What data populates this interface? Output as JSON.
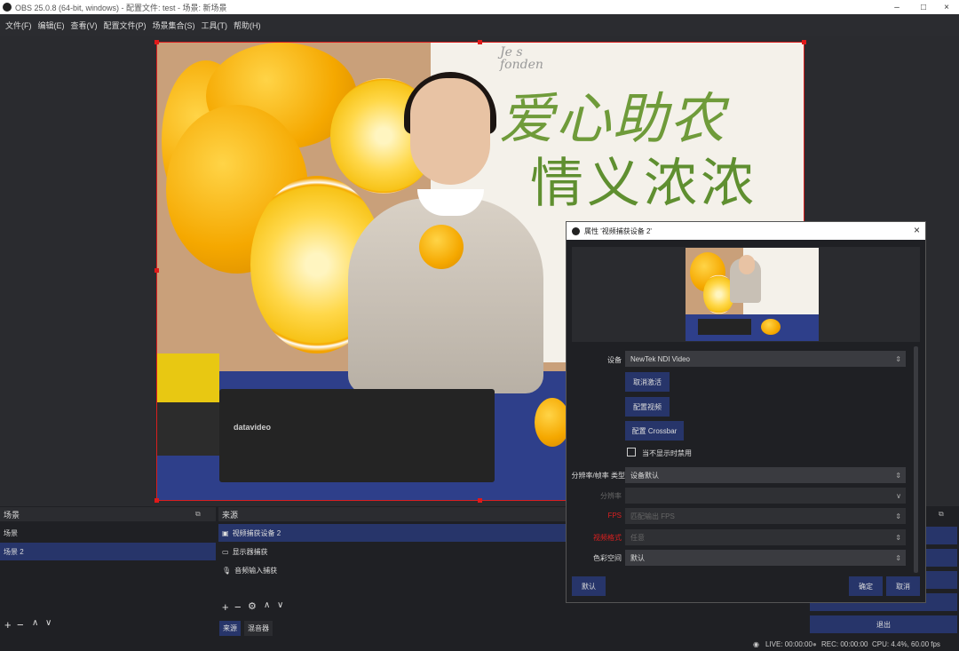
{
  "window": {
    "title": "OBS 25.0.8 (64-bit, windows) - 配置文件: test - 场景: 新场景",
    "minimize": "–",
    "maximize": "□",
    "close": "×"
  },
  "menu": [
    "文件(F)",
    "编辑(E)",
    "查看(V)",
    "配置文件(P)",
    "场景集合(S)",
    "工具(T)",
    "帮助(H)"
  ],
  "preview": {
    "wall_text_line1": "爱心助农",
    "wall_text_line2": "情义浓浓",
    "deco_text": "Je s\nfonden",
    "device_brand": "datavideo"
  },
  "scenes_dock": {
    "title": "场景",
    "items": [
      "场景",
      "场景 2"
    ],
    "selected_index": 1
  },
  "sources_dock": {
    "title": "来源",
    "items": [
      {
        "icon": "camera-icon",
        "label": "视频捕获设备 2"
      },
      {
        "icon": "monitor-icon",
        "label": "显示器捕获"
      },
      {
        "icon": "microphone-icon",
        "label": "音频输入捕获"
      }
    ],
    "selected_index": 0
  },
  "bottom_tabs": [
    "来源",
    "混音器"
  ],
  "controls": {
    "exit_label": "退出"
  },
  "status": {
    "live": "LIVE: 00:00:00",
    "rec": "REC: 00:00:00",
    "cpu": "CPU: 4.4%, 60.00 fps"
  },
  "dialog": {
    "title": "属性 '视频捕获设备 2'",
    "device_label": "设备",
    "device_value": "NewTek NDI Video",
    "btn_deactivate": "取消激活",
    "btn_config_video": "配置视频",
    "btn_config_crossbar": "配置 Crossbar",
    "checkbox_label": "当不显示时禁用",
    "res_type_label": "分辨率/帧率 类型",
    "res_type_value": "设备默认",
    "resolution_label": "分辨率",
    "resolution_value": "",
    "fps_label": "FPS",
    "fps_value": "匹配输出 FPS",
    "video_format_label": "视频格式",
    "video_format_value": "任意",
    "color_space_label": "色彩空间",
    "color_space_value": "默认",
    "btn_defaults": "默认",
    "btn_ok": "确定",
    "btn_cancel": "取消"
  },
  "colors": {
    "accent": "#27356a",
    "selection_border": "#d81e1e",
    "background": "#1f2024"
  }
}
